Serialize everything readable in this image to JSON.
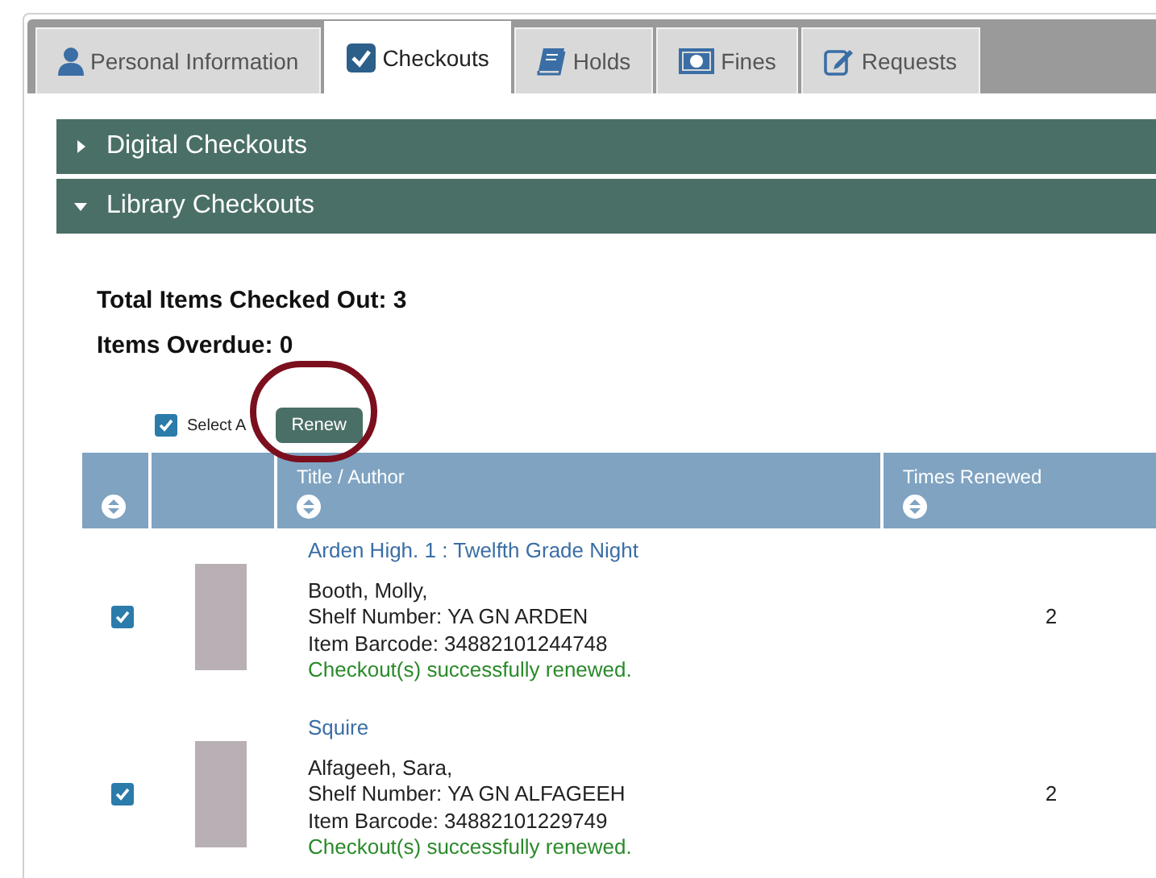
{
  "tabs": [
    {
      "label": "Personal Information",
      "selected": false
    },
    {
      "label": "Checkouts",
      "selected": true
    },
    {
      "label": "Holds",
      "selected": false
    },
    {
      "label": "Fines",
      "selected": false
    },
    {
      "label": "Requests",
      "selected": false
    }
  ],
  "sections": [
    {
      "title": "Digital Checkouts",
      "expanded": false
    },
    {
      "title": "Library Checkouts",
      "expanded": true
    }
  ],
  "summary": [
    "Total Items Checked Out: 3",
    "Items Overdue: 0"
  ],
  "select_all": {
    "label": "Select A",
    "checked": true
  },
  "renew_button": "Renew",
  "table": {
    "columns": [
      "Title / Author",
      "Times Renewed"
    ],
    "rows": [
      {
        "checked": true,
        "title": "Arden High. 1 : Twelfth Grade Night",
        "author": "Booth, Molly,",
        "shelf": "Shelf Number: YA GN ARDEN",
        "barcode": "Item Barcode: 34882101244748",
        "status": "Checkout(s) successfully renewed.",
        "times_renewed": "2"
      },
      {
        "checked": true,
        "title": "Squire",
        "author": "Alfageeh, Sara,",
        "shelf": "Shelf Number: YA GN ALFAGEEH",
        "barcode": "Item Barcode: 34882101229749",
        "status": "Checkout(s) successfully renewed.",
        "times_renewed": "2"
      }
    ]
  }
}
